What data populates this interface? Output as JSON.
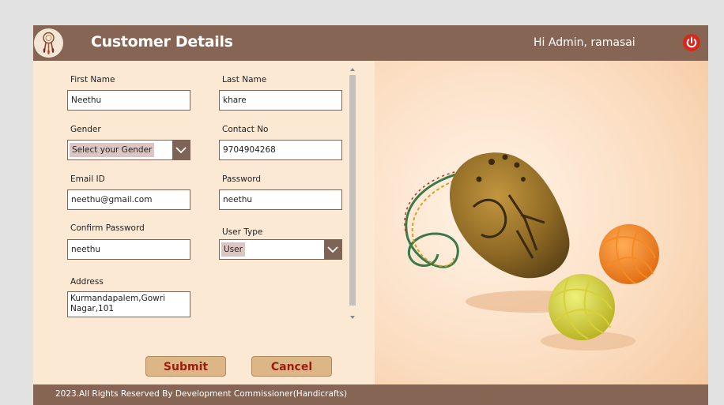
{
  "header": {
    "title": "Customer Details",
    "greeting": "Hi Admin, ramasai"
  },
  "form": {
    "first_name": {
      "label": "First Name",
      "value": "Neethu"
    },
    "last_name": {
      "label": "Last Name",
      "value": "khare"
    },
    "gender": {
      "label": "Gender",
      "value": "Select your Gender"
    },
    "contact": {
      "label": "Contact No",
      "value": "9704904268"
    },
    "email": {
      "label": "Email ID",
      "value": "neethu@gmail.com"
    },
    "password": {
      "label": "Password",
      "value": "neethu"
    },
    "confirm_password": {
      "label": "Confirm Password",
      "value": "neethu"
    },
    "user_type": {
      "label": "User Type",
      "value": "User"
    },
    "address": {
      "label": "Address",
      "value": "Kurmandapalem,Gowri Nagar,101"
    }
  },
  "buttons": {
    "submit": "Submit",
    "cancel": "Cancel"
  },
  "footer": {
    "text": "2023.All Rights Reserved By Development Commissioner(Handicrafts)"
  },
  "colors": {
    "header_bg": "#876554",
    "form_bg": "#fbe9d4",
    "button_bg": "#ddb685",
    "button_text": "#9d1b12",
    "power_icon": "#d8281c"
  },
  "icons": {
    "logo": "dreamcatcher-icon",
    "power": "power-icon",
    "dropdown": "chevron-down-icon"
  }
}
